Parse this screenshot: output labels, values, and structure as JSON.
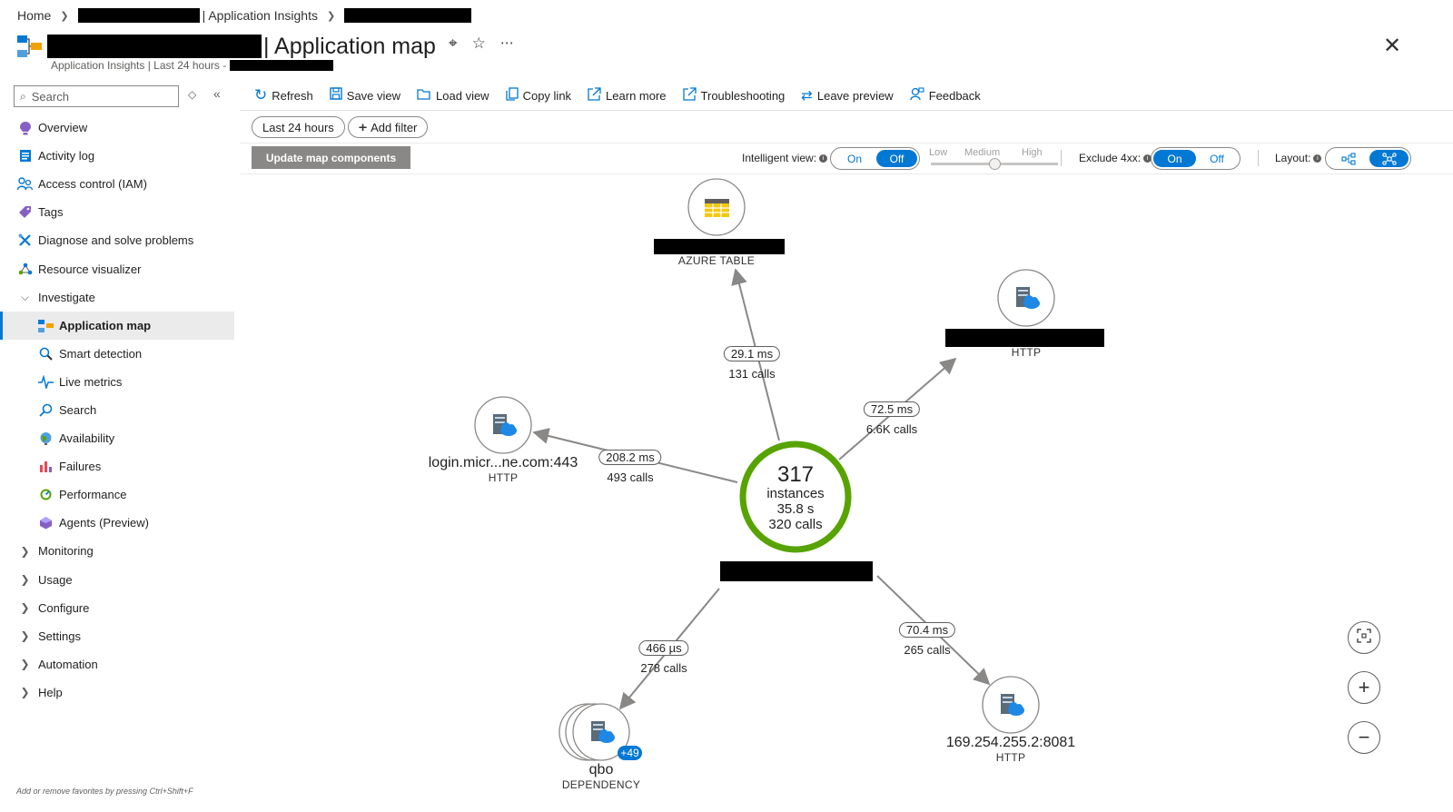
{
  "breadcrumb": {
    "home": "Home",
    "resource_suffix": "| Application Insights"
  },
  "header": {
    "title": "| Application map",
    "subtitle_prefix": "Application Insights | Last 24 hours -"
  },
  "nav": {
    "search_placeholder": "Search",
    "items": [
      {
        "label": "Overview",
        "icon": "bulb-icon"
      },
      {
        "label": "Activity log",
        "icon": "log-icon"
      },
      {
        "label": "Access control (IAM)",
        "icon": "people-icon"
      },
      {
        "label": "Tags",
        "icon": "tag-icon"
      },
      {
        "label": "Diagnose and solve problems",
        "icon": "wrench-icon"
      },
      {
        "label": "Resource visualizer",
        "icon": "graph-icon"
      },
      {
        "label": "Investigate",
        "icon": "chevron-down-icon"
      }
    ],
    "investigate_items": [
      {
        "label": "Application map",
        "icon": "app-map-icon"
      },
      {
        "label": "Smart detection",
        "icon": "magnifier-icon"
      },
      {
        "label": "Live metrics",
        "icon": "pulse-icon"
      },
      {
        "label": "Search",
        "icon": "search-icon"
      },
      {
        "label": "Availability",
        "icon": "globe-icon"
      },
      {
        "label": "Failures",
        "icon": "bar-chart-icon"
      },
      {
        "label": "Performance",
        "icon": "performance-icon"
      },
      {
        "label": "Agents (Preview)",
        "icon": "agents-icon"
      }
    ],
    "groups": [
      {
        "label": "Monitoring"
      },
      {
        "label": "Usage"
      },
      {
        "label": "Configure"
      },
      {
        "label": "Settings"
      },
      {
        "label": "Automation"
      },
      {
        "label": "Help"
      }
    ],
    "favorites_hint": "Add or remove favorites by pressing Ctrl+Shift+F"
  },
  "toolbar": {
    "refresh": "Refresh",
    "save_view": "Save view",
    "load_view": "Load view",
    "copy_link": "Copy link",
    "learn_more": "Learn more",
    "troubleshooting": "Troubleshooting",
    "leave_preview": "Leave preview",
    "feedback": "Feedback"
  },
  "filters": {
    "time_range": "Last 24 hours",
    "add_filter": "Add filter",
    "update_button": "Update map components"
  },
  "controls": {
    "intelligent_view_label": "Intelligent view:",
    "intelligent_view_options": [
      "On",
      "Off"
    ],
    "intelligent_view_selected": "Off",
    "sensitivity_levels": [
      "Low",
      "Medium",
      "High"
    ],
    "sensitivity_selected": "Medium",
    "exclude_4xx_label": "Exclude 4xx:",
    "exclude_4xx_options": [
      "On",
      "Off"
    ],
    "exclude_4xx_selected": "On",
    "layout_label": "Layout:",
    "layout_selected": "force"
  },
  "map": {
    "center": {
      "count": "317",
      "count_label": "instances",
      "duration": "35.8 s",
      "calls": "320 calls",
      "health_color": "#57a300"
    },
    "nodes": {
      "azure_table": {
        "type": "AZURE TABLE"
      },
      "http_top": {
        "type": "HTTP"
      },
      "login": {
        "name": "login.micr...ne.com:443",
        "type": "HTTP"
      },
      "qbo": {
        "name": "qbo",
        "type": "DEPENDENCY",
        "badge": "+49"
      },
      "ip": {
        "name": "169.254.255.2:8081",
        "type": "HTTP"
      }
    },
    "edges": {
      "azure_table": {
        "duration": "29.1 ms",
        "calls": "131 calls"
      },
      "http_top": {
        "duration": "72.5 ms",
        "calls": "6.6K calls"
      },
      "login": {
        "duration": "208.2 ms",
        "calls": "493 calls"
      },
      "qbo": {
        "duration": "466 µs",
        "calls": "278 calls"
      },
      "ip": {
        "duration": "70.4 ms",
        "calls": "265 calls"
      }
    }
  },
  "colors": {
    "accent": "#0078d4",
    "healthy": "#57a300"
  }
}
